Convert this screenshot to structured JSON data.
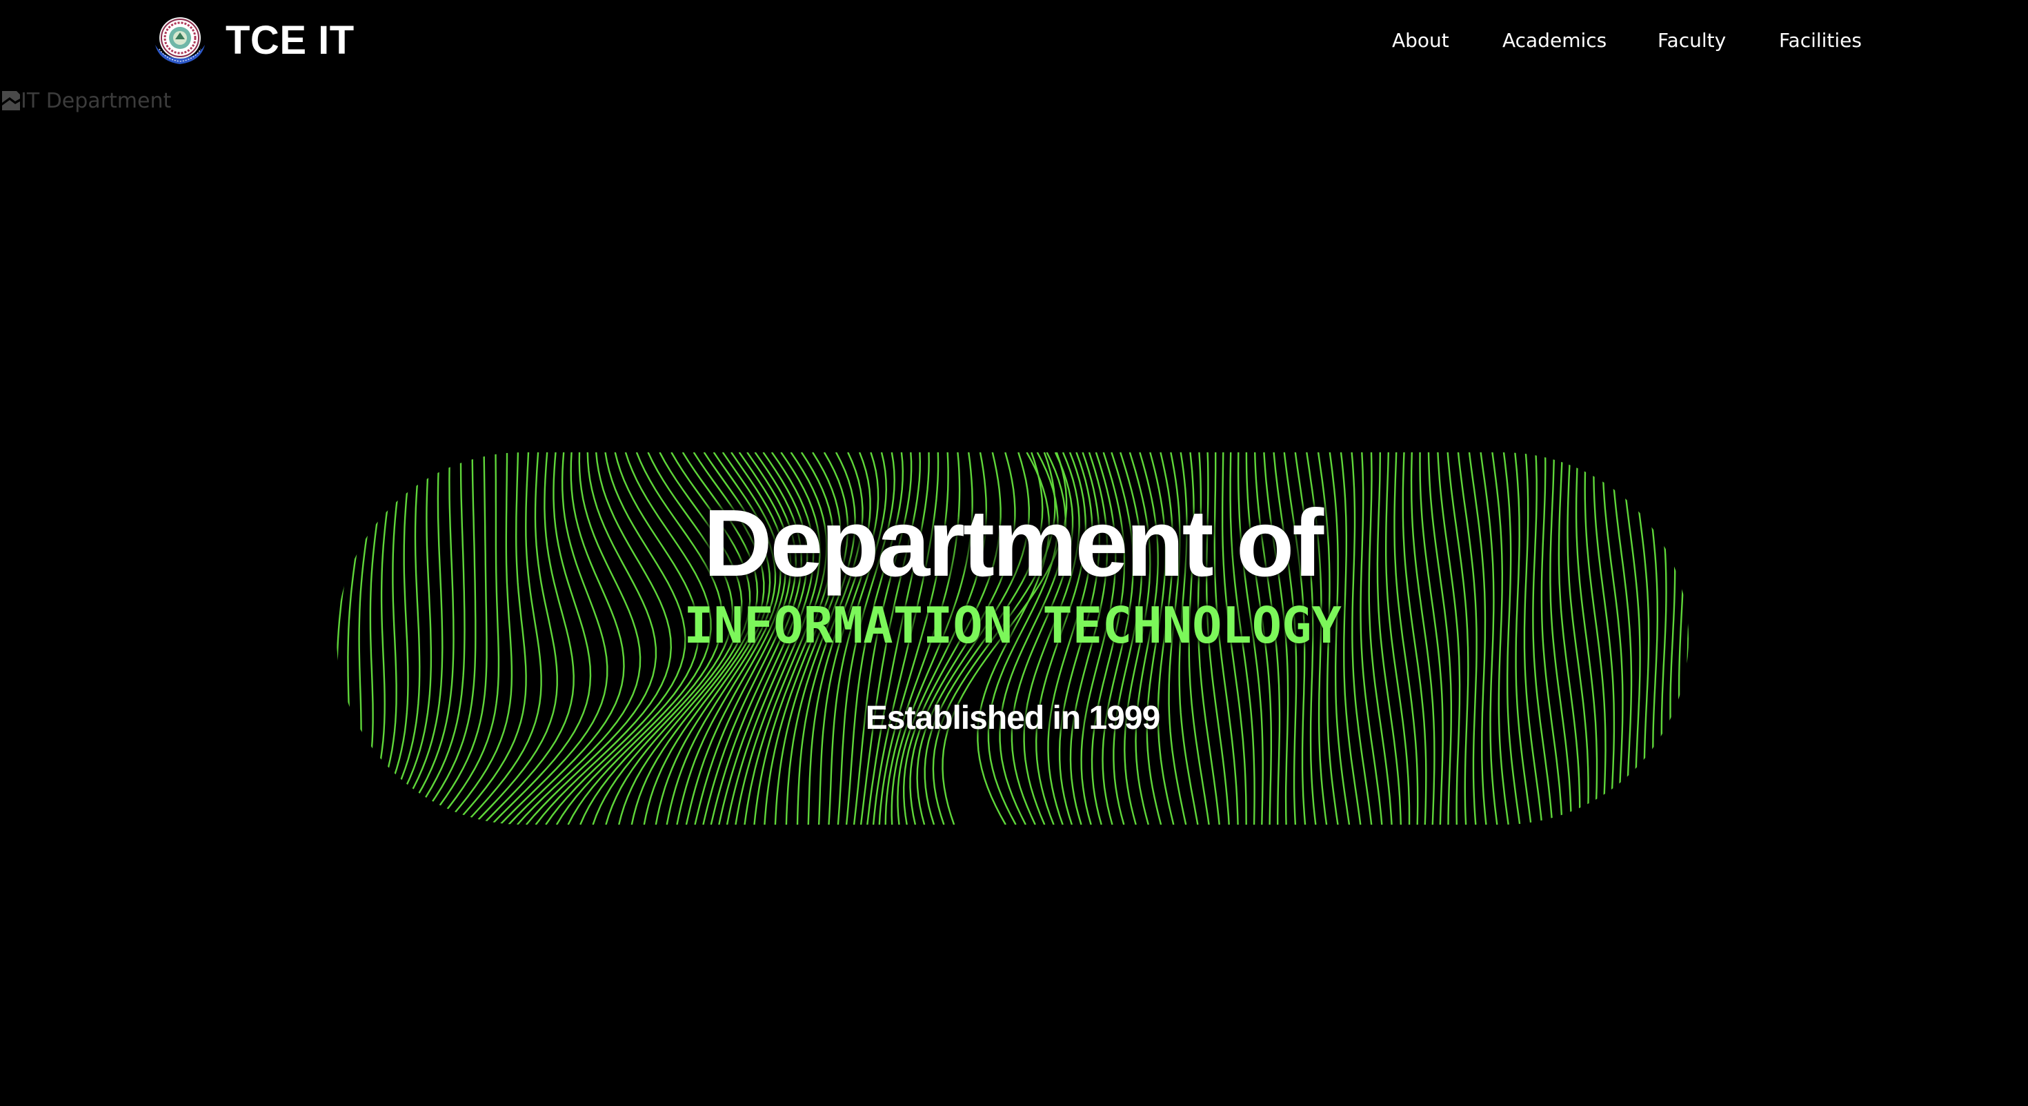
{
  "navbar": {
    "brand_name": "TCE IT",
    "links": [
      {
        "label": "About"
      },
      {
        "label": "Academics"
      },
      {
        "label": "Faculty"
      },
      {
        "label": "Facilities"
      }
    ]
  },
  "banner_image": {
    "alt_text": "IT Department"
  },
  "hero": {
    "title": "Department of",
    "subtitle": "INFORMATION TECHNOLOGY",
    "established": "Established in 1999"
  },
  "colors": {
    "background": "#000000",
    "text": "#ffffff",
    "accent": "#7cf75a",
    "wave_lines": "#5fd63a",
    "broken_image_text": "#3c3c3c"
  },
  "icons": {
    "logo": "college-seal-icon",
    "broken_image": "broken-image-icon"
  }
}
